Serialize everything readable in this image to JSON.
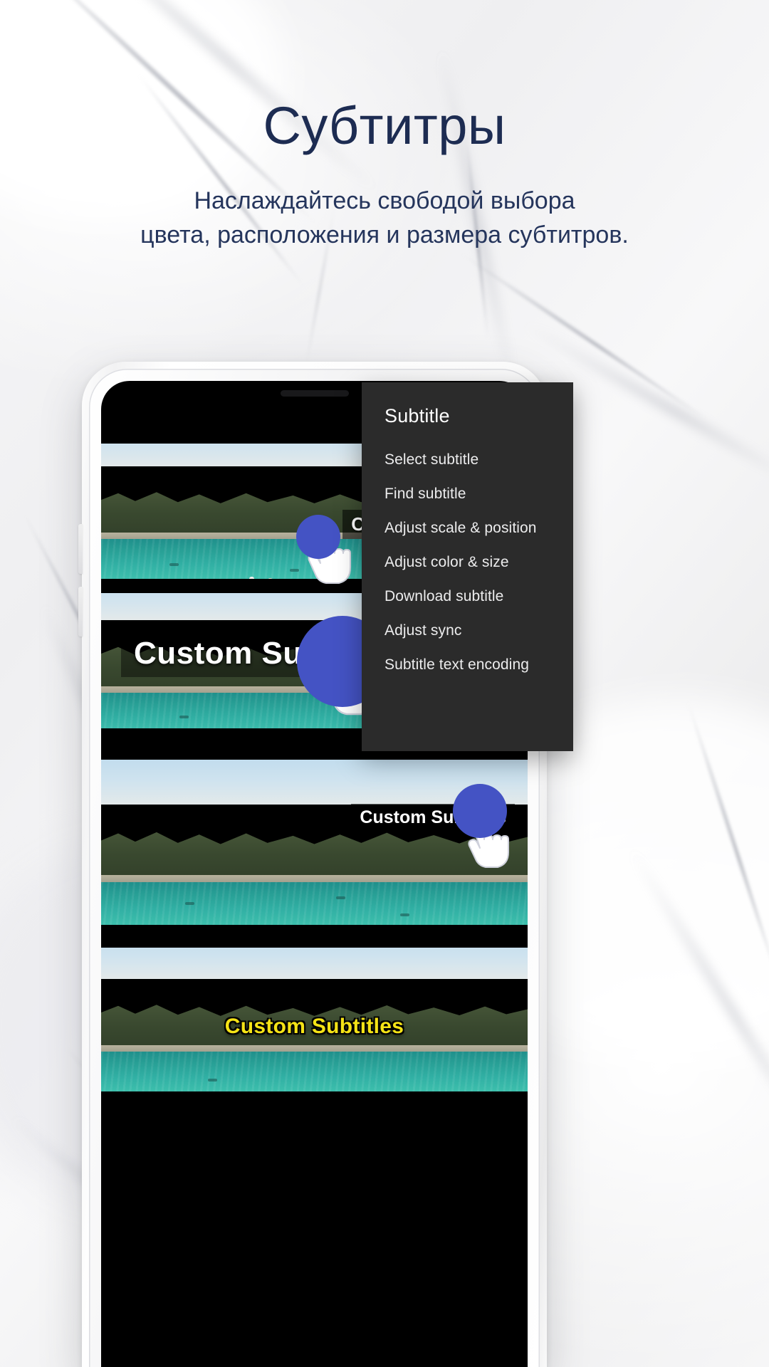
{
  "header": {
    "title": "Субтитры",
    "subtitle_line1": "Наслаждайтесь свободой выбора",
    "subtitle_line2": "цвета, расположения и размера субтитров.",
    "title_color": "#1d2c52",
    "subtitle_color": "#25355c"
  },
  "menu": {
    "title": "Subtitle",
    "background_color": "#2b2b2b",
    "items": [
      {
        "label": "Select subtitle"
      },
      {
        "label": "Find subtitle"
      },
      {
        "label": "Adjust scale & position"
      },
      {
        "label": "Adjust color & size"
      },
      {
        "label": "Download subtitle"
      },
      {
        "label": "Adjust sync"
      },
      {
        "label": "Subtitle text encoding"
      }
    ]
  },
  "player": {
    "accent_color": "#4453c4",
    "frames": [
      {
        "caption": "Custom Subtitles",
        "style": "small-right"
      },
      {
        "caption": "Custom Subtitles",
        "style": "large-center"
      },
      {
        "caption": "Custom Subtitles",
        "style": "small-right-lower"
      },
      {
        "caption": "Custom Subtitles",
        "style": "yellow-outline"
      }
    ]
  },
  "icons": {
    "cursor_tap": "hand-tap-icon",
    "cursor_resize": "hand-resize-icon",
    "cursor_move": "hand-move-icon",
    "notch_speaker": "speaker-grille-icon",
    "notch_camera": "front-camera-icon"
  }
}
